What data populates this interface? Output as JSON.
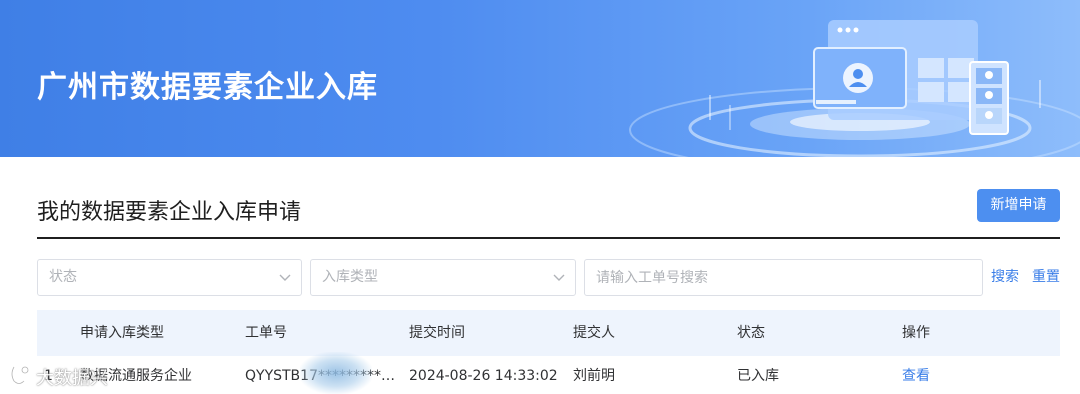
{
  "banner": {
    "title": "广州市数据要素企业入库"
  },
  "section": {
    "title": "我的数据要素企业入库申请",
    "new_button_label": "新增申请"
  },
  "filters": {
    "status_placeholder": "状态",
    "type_placeholder": "入库类型",
    "search_placeholder": "请输入工单号搜索",
    "search_label": "搜索",
    "reset_label": "重置"
  },
  "table": {
    "columns": [
      "申请入库类型",
      "工单号",
      "提交时间",
      "提交人",
      "状态",
      "操作"
    ],
    "rows": [
      {
        "index": "1",
        "type": "数据流通服务企业",
        "ticket": "QYYSTB17**********463...",
        "submitted_at": "2024-08-26 14:33:02",
        "submitter": "刘前明",
        "status": "已入库",
        "action": "查看"
      }
    ]
  },
  "watermark": {
    "text": "大数据兴"
  },
  "colors": {
    "banner_start": "#3f7fe6",
    "banner_end": "#8ebdfb",
    "primary": "#4d8ff0",
    "link": "#3a7ee8",
    "header_row": "#eef4fd"
  }
}
